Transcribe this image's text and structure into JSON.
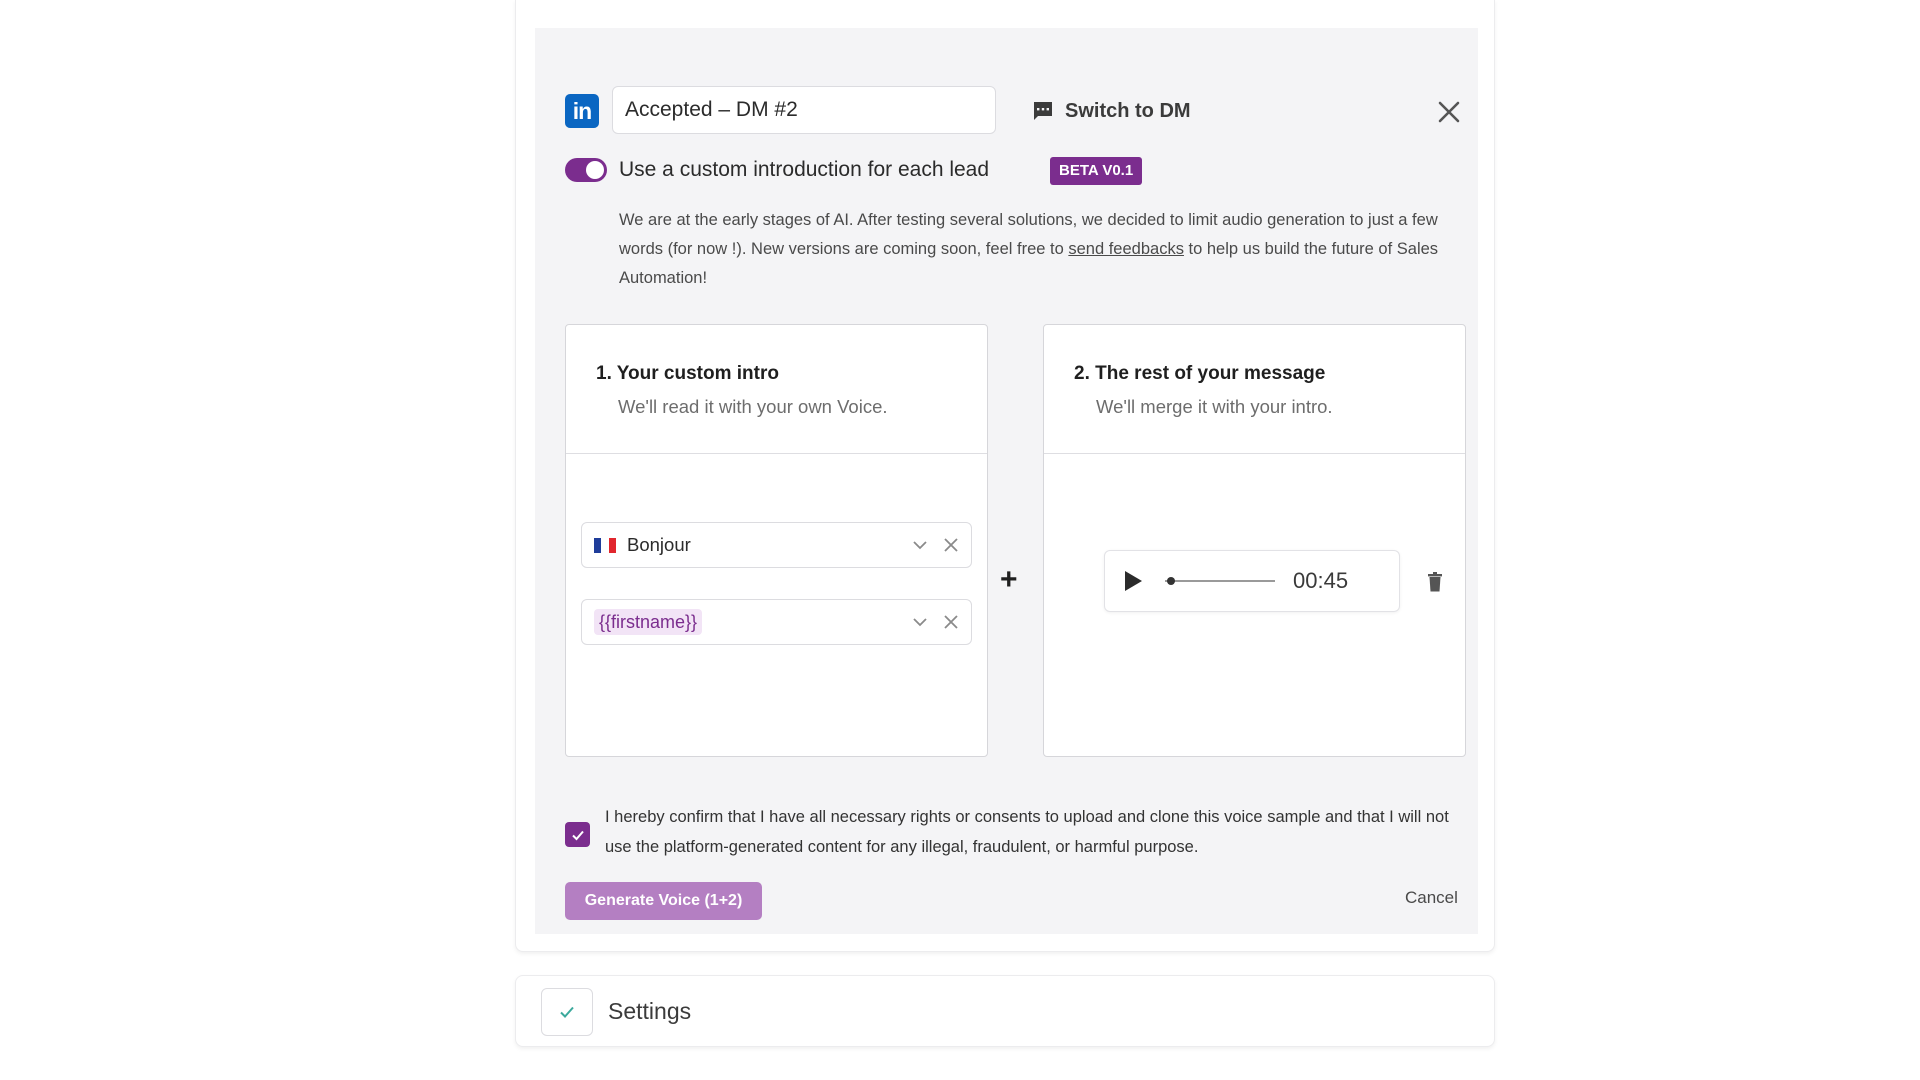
{
  "step": {
    "channel_icon": "linkedin-icon",
    "name_value": "Accepted – DM #2",
    "switch_label": "Switch to DM",
    "custom_intro": {
      "enabled": true,
      "label": "Use a custom introduction for each lead",
      "badge": "BETA V0.1"
    },
    "notice": {
      "before_link": "We are at the early stages of AI. After testing several solutions, we decided to limit audio generation to just a few words (for now !). New versions are coming soon, feel free to ",
      "link_text": "send feedbacks",
      "after_link": " to help us build the future of Sales Automation!"
    }
  },
  "intro_box": {
    "title": "1. Your custom intro",
    "subtitle": "We'll read it with your own Voice.",
    "rows": [
      {
        "text": "Bonjour",
        "flag": "fr-flag-icon"
      },
      {
        "variable": "{{firstname}}"
      }
    ]
  },
  "rest_box": {
    "title": "2. The rest of your message",
    "subtitle": "We'll merge it with your intro.",
    "audio": {
      "time": "00:45",
      "progress": 0.02
    }
  },
  "plus_sign": "+",
  "consent": {
    "checked": true,
    "text": "I hereby confirm that I have all necessary rights or consents to upload and clone this voice sample and that I will not use the platform-generated content for any illegal, fraudulent, or harmful purpose."
  },
  "actions": {
    "generate_label": "Generate Voice (1+2)",
    "cancel_label": "Cancel"
  },
  "settings": {
    "label": "Settings"
  },
  "colors": {
    "accent": "#7b2d8e",
    "linkedin": "#0a66c2",
    "generate_button": "#b47fc2",
    "check_teal": "#3ba99c"
  }
}
